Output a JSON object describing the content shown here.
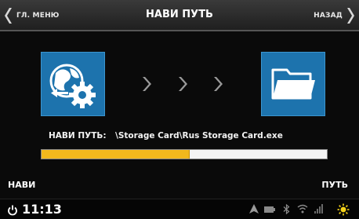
{
  "header": {
    "back_menu_label": "ГЛ. МЕНЮ",
    "title": "НАВИ ПУТЬ",
    "back_label": "НАЗАД"
  },
  "main": {
    "source_icon": "globe-gear-icon",
    "target_icon": "folder-icon",
    "path_label": "НАВИ ПУТЬ:",
    "path_value": "\\Storage Card\\Rus Storage Card.exe",
    "progress_fraction": 0.52
  },
  "footer": {
    "left_button": "НАВИ",
    "right_button": "ПУТЬ"
  },
  "statusbar": {
    "time": "11:13",
    "icons": [
      "navigation-icon",
      "battery-icon",
      "bluetooth-icon",
      "wifi-icon",
      "signal-icon",
      "brightness-icon"
    ]
  },
  "colors": {
    "tile_blue": "#1d73ad",
    "progress_yellow": "#f2b81d"
  }
}
